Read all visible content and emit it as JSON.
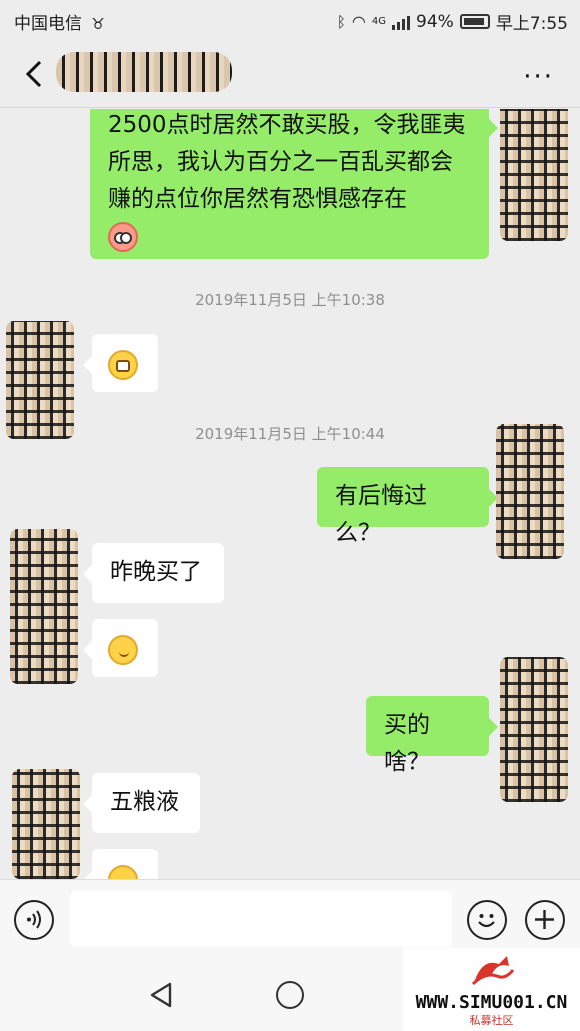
{
  "status_bar": {
    "carrier": "中国电信",
    "network": "4G",
    "battery": "94%",
    "time": "早上7:55"
  },
  "header": {
    "more_label": "···"
  },
  "messages": [
    {
      "side": "me",
      "text": "2500点时居然不敢买股，令我匪夷所思，我认为百分之一百乱买都会赚的点位你居然有恐惧感存在",
      "emoji": "flushed-face"
    },
    {
      "timestamp": "2019年11月5日 上午10:38"
    },
    {
      "side": "other",
      "emoji": "grimacing-face"
    },
    {
      "timestamp": "2019年11月5日 上午10:44"
    },
    {
      "side": "me",
      "text": "有后悔过么？"
    },
    {
      "side": "other",
      "text": "昨晚买了"
    },
    {
      "side": "other",
      "emoji": "smirking-face"
    },
    {
      "side": "me",
      "text": "买的啥？"
    },
    {
      "side": "other",
      "text": "五粮液"
    },
    {
      "side": "other",
      "emoji": "smirking-face"
    }
  ],
  "icons": [
    "back-icon",
    "more-icon",
    "voice-icon",
    "emoji-icon",
    "plus-icon",
    "nav-back-icon",
    "nav-home-icon"
  ],
  "watermark": {
    "url": "WWW.SIMU001.CN",
    "subtitle": "私募社区"
  },
  "colors": {
    "my_bubble": "#95ec69",
    "other_bubble": "#ffffff",
    "background": "#ededed"
  }
}
